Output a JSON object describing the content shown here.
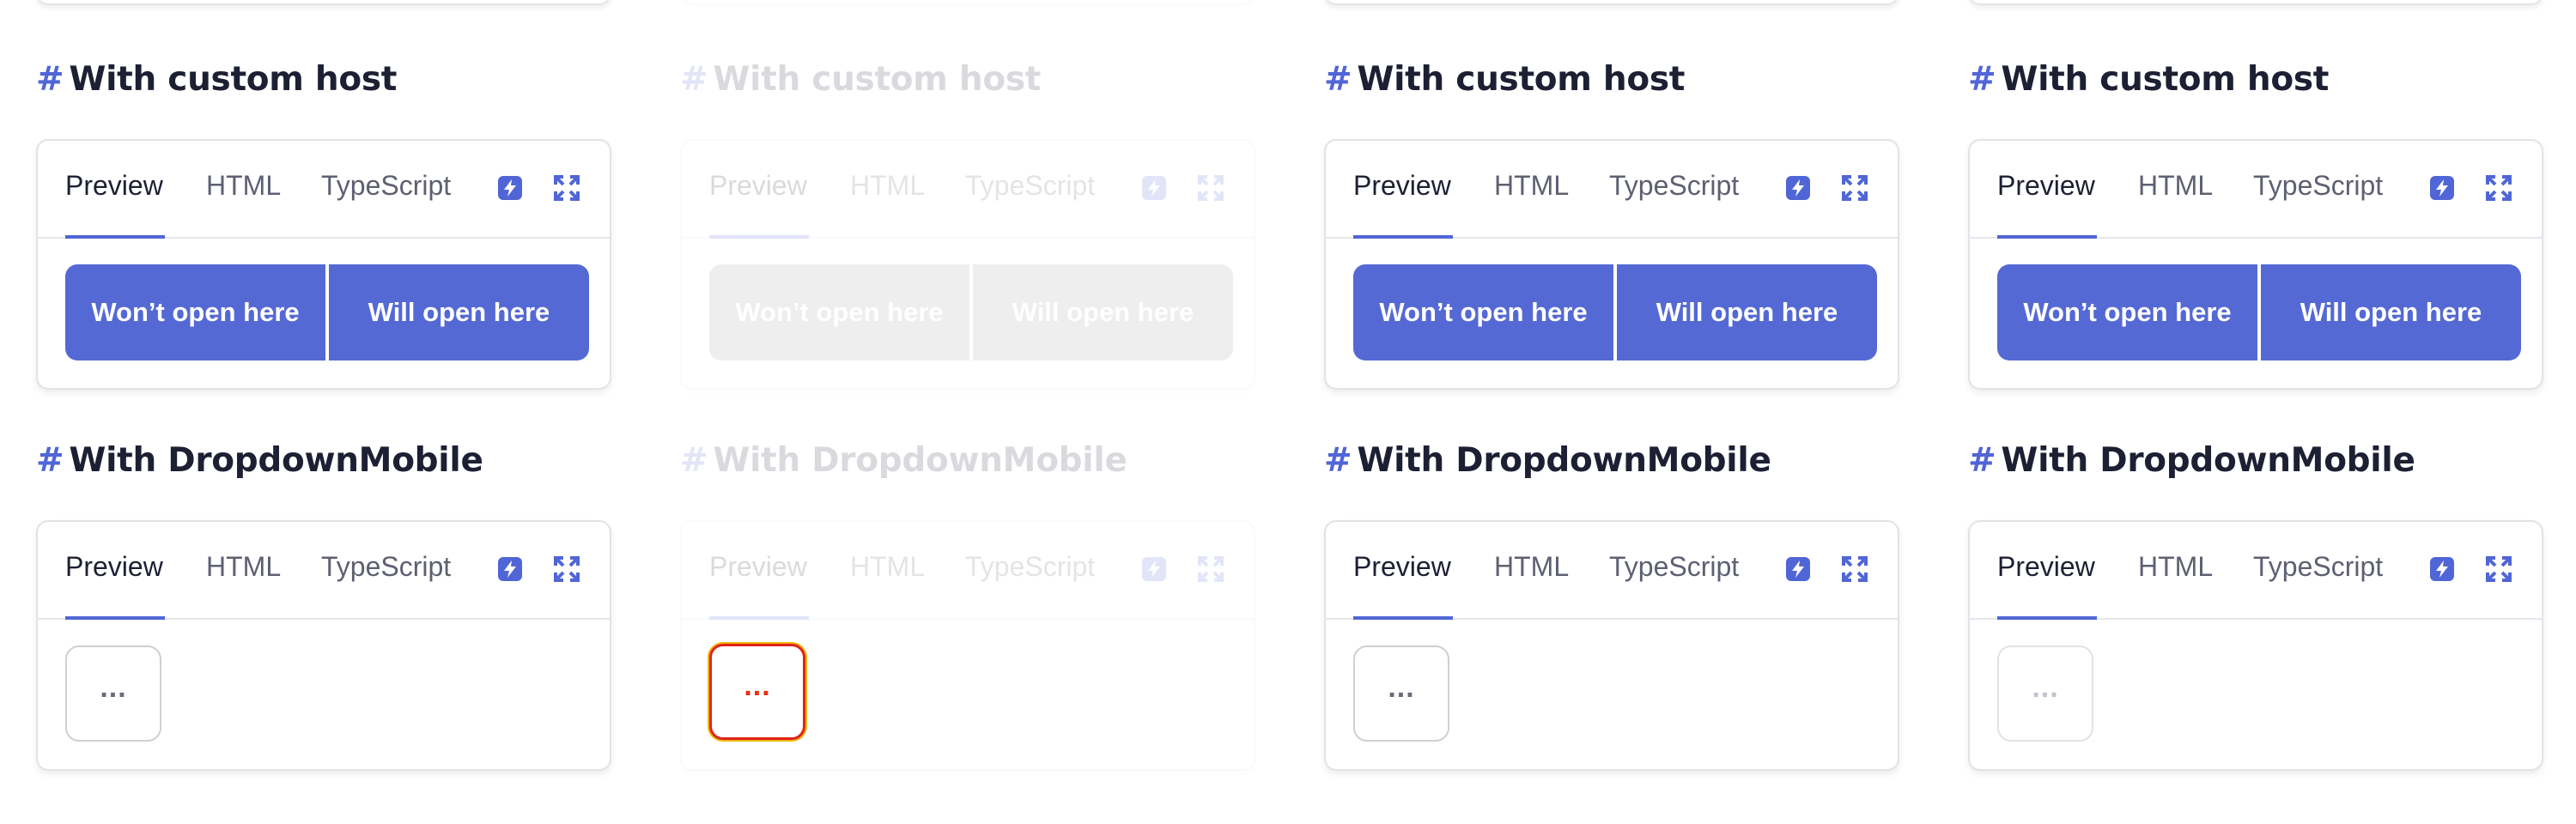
{
  "columns": [
    {
      "id": "c1",
      "state": "normal",
      "menu_state": "normal"
    },
    {
      "id": "c2",
      "state": "faded",
      "menu_state": "focused"
    },
    {
      "id": "c3",
      "state": "normal",
      "menu_state": "normal"
    },
    {
      "id": "c4",
      "state": "normal",
      "menu_state": "light"
    }
  ],
  "sections": {
    "custom_host": {
      "hash": "#",
      "title": "With custom host",
      "buttons": {
        "left": "Won’t open here",
        "right": "Will open here"
      }
    },
    "dropdown_mobile": {
      "hash": "#",
      "title": "With DropdownMobile",
      "menu_label": "..."
    }
  },
  "tabs": {
    "preview": "Preview",
    "html": "HTML",
    "typescript": "TypeScript"
  },
  "icons": {
    "sandbox": "lightning-icon",
    "expand": "expand-icon"
  },
  "colors": {
    "accent": "#5166d6",
    "button": "#5469d4",
    "heading": "#1d2033",
    "focus_ring": "#e0231b"
  }
}
